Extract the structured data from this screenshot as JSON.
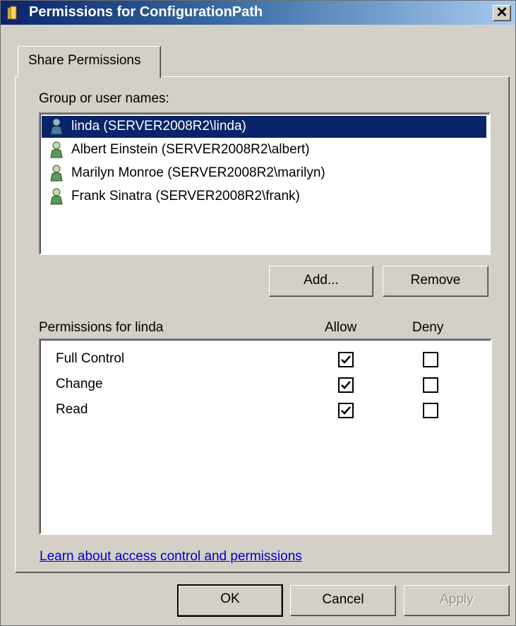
{
  "window": {
    "title": "Permissions for ConfigurationPath",
    "close_glyph": "✕"
  },
  "tabs": [
    {
      "label": "Share Permissions"
    }
  ],
  "users_section": {
    "label": "Group or user names:",
    "items": [
      {
        "label": "linda (SERVER2008R2\\linda)",
        "selected": true
      },
      {
        "label": "Albert Einstein (SERVER2008R2\\albert)",
        "selected": false
      },
      {
        "label": "Marilyn Monroe (SERVER2008R2\\marilyn)",
        "selected": false
      },
      {
        "label": "Frank Sinatra (SERVER2008R2\\frank)",
        "selected": false
      }
    ],
    "add_label": "Add...",
    "remove_label": "Remove"
  },
  "permissions": {
    "header": "Permissions for linda",
    "allow_header": "Allow",
    "deny_header": "Deny",
    "rows": [
      {
        "name": "Full Control",
        "allow": true,
        "deny": false
      },
      {
        "name": "Change",
        "allow": true,
        "deny": false
      },
      {
        "name": "Read",
        "allow": true,
        "deny": false
      }
    ]
  },
  "help_link": "Learn about access control and permissions",
  "footer": {
    "ok_label": "OK",
    "cancel_label": "Cancel",
    "apply_label": "Apply"
  },
  "colors": {
    "selection": "#0a246a",
    "dialog_bg": "#d4d0c8",
    "link": "#0000cc"
  },
  "icons": {
    "title": "folder-icon",
    "user": "user-icon",
    "check": "checkmark-icon"
  }
}
